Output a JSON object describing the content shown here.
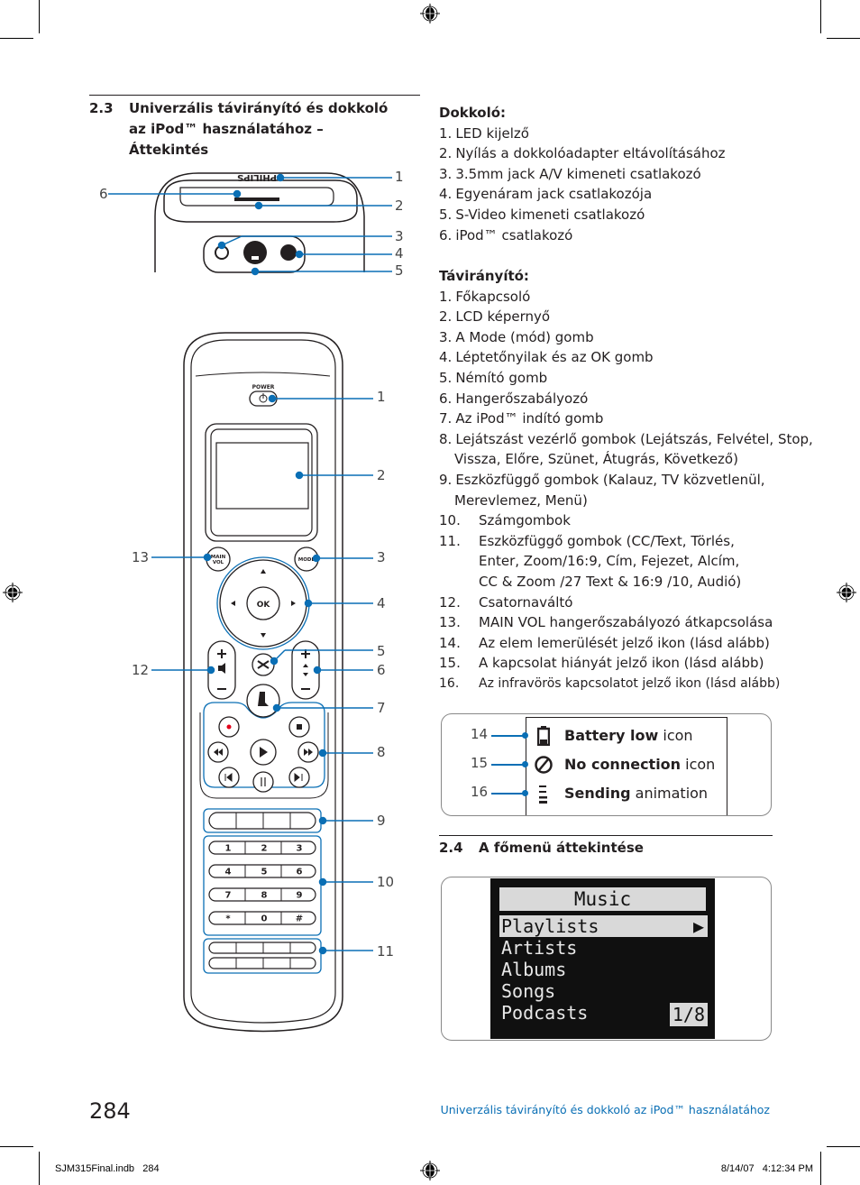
{
  "section_2_3": {
    "number": "2.3",
    "title": "Univerzális távirányító és dokkoló az iPod™ használatához – Áttekintés"
  },
  "dock": {
    "heading": "Dokkoló:",
    "items": [
      {
        "n": "1.",
        "text": "LED kijelző"
      },
      {
        "n": "2.",
        "text": "Nyílás a dokkolóadapter eltávolításához"
      },
      {
        "n": "3.",
        "text": "3.5mm jack A/V kimeneti csatlakozó"
      },
      {
        "n": "4.",
        "text": "Egyenáram jack csatlakozója"
      },
      {
        "n": "5.",
        "text": "S-Video kimeneti csatlakozó"
      },
      {
        "n": "6.",
        "text": "iPod™ csatlakozó"
      }
    ],
    "brand_label": "PHILIPS",
    "callouts": [
      "1",
      "2",
      "3",
      "4",
      "5",
      "6"
    ]
  },
  "remote": {
    "heading": "Távirányító:",
    "items": [
      {
        "n": "1.",
        "text": "Főkapcsoló"
      },
      {
        "n": "2.",
        "text": "LCD képernyő"
      },
      {
        "n": "3.",
        "text": "A Mode (mód) gomb"
      },
      {
        "n": "4.",
        "text": "Léptetőnyilak és az OK gomb"
      },
      {
        "n": "5.",
        "text": "Némító gomb"
      },
      {
        "n": "6.",
        "text": "Hangerőszabályozó"
      },
      {
        "n": "7.",
        "text": "Az iPod™ indító gomb"
      },
      {
        "n": "8.",
        "text": "Lejátszást vezérlő gombok (Lejátszás, Felvétel, Stop,",
        "cont": "Vissza, Előre, Szünet, Átugrás, Következő)"
      },
      {
        "n": "9.",
        "text": "Eszközfüggő gombok (Kalauz, TV közvetlenül,",
        "cont": "Merevlemez, Menü)"
      },
      {
        "n": "10.",
        "text": "Számgombok"
      },
      {
        "n": "11.",
        "text": "Eszközfüggő gombok (CC/Text, Törlés,",
        "cont": "Enter, Zoom/16:9, Cím, Fejezet, Alcím,",
        "cont2": "CC & Zoom /27 Text & 16:9 /10, Audió)"
      },
      {
        "n": "12.",
        "text": "Csatornaváltó"
      },
      {
        "n": "13.",
        "text": "MAIN VOL hangerőszabályozó átkapcsolása"
      },
      {
        "n": "14.",
        "text": "Az elem lemerülését jelző ikon (lásd alább)"
      },
      {
        "n": "15.",
        "text": "A kapcsolat hiányát jelző ikon (lásd alább)"
      },
      {
        "n": "16.",
        "text": "Az infravörös kapcsolatot jelző ikon (lásd alább)"
      }
    ],
    "labels": {
      "power": "POWER",
      "main_vol": "MAIN VOL",
      "mode": "MODE",
      "ok": "OK",
      "keypad": [
        "1",
        "2",
        "3",
        "4",
        "5",
        "6",
        "7",
        "8",
        "9",
        "*",
        "0",
        "#"
      ]
    },
    "callouts": [
      "1",
      "2",
      "3",
      "4",
      "5",
      "6",
      "7",
      "8",
      "9",
      "10",
      "11",
      "12",
      "13"
    ]
  },
  "status_icons": {
    "rows": [
      {
        "num": "14",
        "icon": "battery-low-icon",
        "bold": "Battery low",
        "rest": " icon"
      },
      {
        "num": "15",
        "icon": "no-connection-icon",
        "bold": "No connection",
        "rest": " icon"
      },
      {
        "num": "16",
        "icon": "sending-animation-icon",
        "bold": "Sending",
        "rest": " animation"
      }
    ]
  },
  "section_2_4": {
    "number": "2.4",
    "title": "A főmenü áttekintése"
  },
  "lcd_menu": {
    "title": "Music",
    "items": [
      "Playlists",
      "Artists",
      "Albums",
      "Songs",
      "Podcasts"
    ],
    "selected_arrow": "▶",
    "page": "1/8"
  },
  "footer": {
    "page_number": "284",
    "running_title": "Univerzális távirányító és dokkoló az iPod™ használatához",
    "slug_file": "SJM315Final.indb   284",
    "slug_date": "8/14/07   4:12:34 PM"
  },
  "colors": {
    "callout_blue": "#0a6fb5",
    "record_red": "#e2001a"
  }
}
